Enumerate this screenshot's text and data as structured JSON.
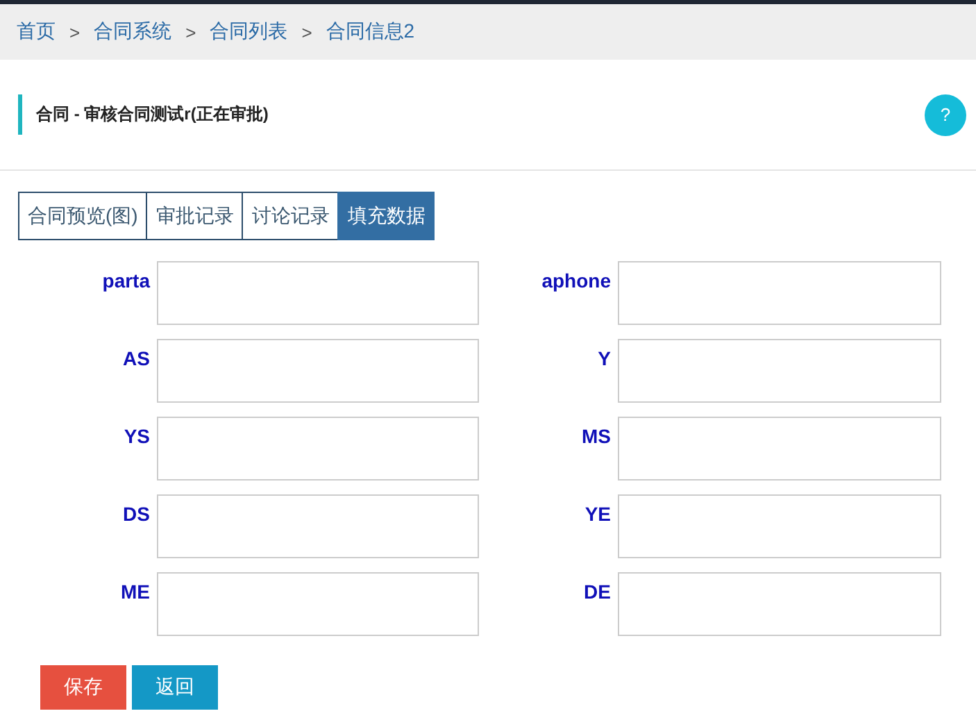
{
  "breadcrumb": [
    "首页",
    "合同系统",
    "合同列表",
    "合同信息2"
  ],
  "breadcrumb_separator": ">",
  "title": "合同 - 审核合同测试r(正在审批)",
  "help_button": "?",
  "tabs": [
    {
      "label": "合同预览(图)",
      "selected": false
    },
    {
      "label": "审批记录",
      "selected": false
    },
    {
      "label": "讨论记录",
      "selected": false
    },
    {
      "label": "填充数据",
      "selected": true
    }
  ],
  "fields": [
    {
      "label": "parta"
    },
    {
      "label": "aphone"
    },
    {
      "label": "AS"
    },
    {
      "label": "Y"
    },
    {
      "label": "YS"
    },
    {
      "label": "MS"
    },
    {
      "label": "DS"
    },
    {
      "label": "YE"
    },
    {
      "label": "ME"
    },
    {
      "label": "DE"
    }
  ],
  "buttons": [
    {
      "label": "保存",
      "kind": "primary"
    },
    {
      "label": "返回",
      "kind": "secondary"
    }
  ]
}
